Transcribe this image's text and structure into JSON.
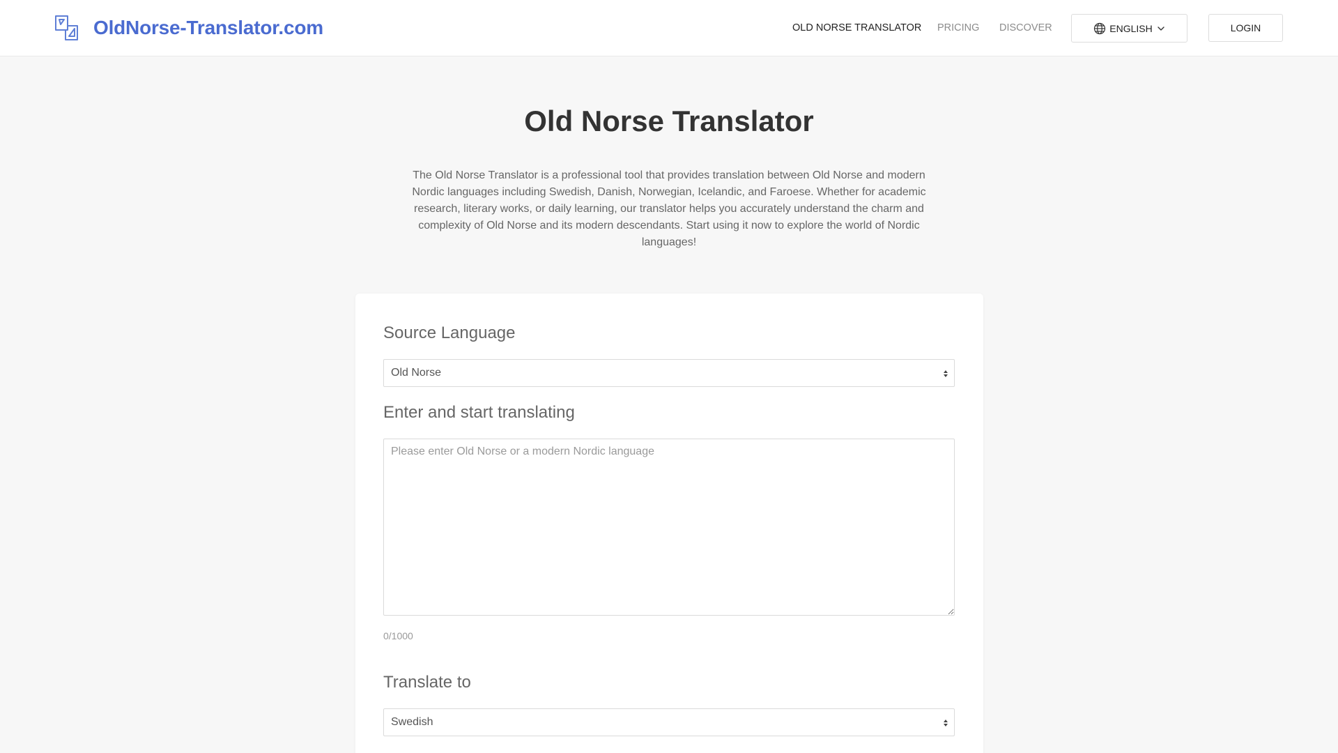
{
  "header": {
    "logo_text": "OldNorse-Translator.com",
    "nav": {
      "translator": "OLD NORSE TRANSLATOR",
      "pricing": "PRICING",
      "discover": "DISCOVER"
    },
    "language_button": "ENGLISH",
    "login_button": "LOGIN"
  },
  "hero": {
    "title": "Old Norse Translator",
    "intro": "The Old Norse Translator is a professional tool that provides translation between Old Norse and modern Nordic languages including Swedish, Danish, Norwegian, Icelandic, and Faroese. Whether for academic research, literary works, or daily learning, our translator helps you accurately understand the charm and complexity of Old Norse and its modern descendants. Start using it now to explore the world of Nordic languages!"
  },
  "form": {
    "source_label": "Source Language",
    "source_value": "Old Norse",
    "input_label": "Enter and start translating",
    "input_value": "",
    "input_placeholder": "Please enter Old Norse or a modern Nordic language",
    "char_count": "0/1000",
    "target_label": "Translate to",
    "target_value": "Swedish"
  },
  "colors": {
    "brand": "#4a6bd0",
    "page_background": "#f7f7f7",
    "nav_active": "#222222",
    "nav_muted": "#8c8c8c"
  },
  "icons": {
    "logo": "translate-icon",
    "language": "globe-icon",
    "language_caret": "chevron-down-icon",
    "select_arrows": "select-arrows-icon"
  }
}
